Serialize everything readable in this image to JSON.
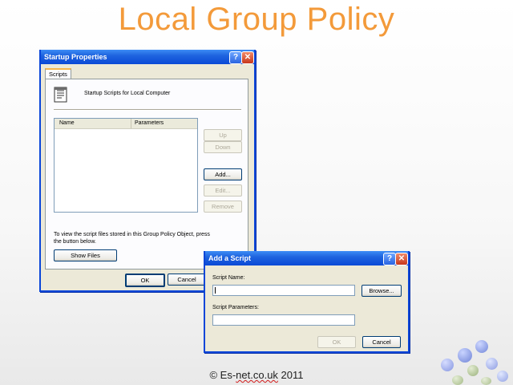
{
  "slide": {
    "title": "Local Group Policy",
    "footer_prefix": "© Es-",
    "footer_wavy": "net.co.uk",
    "footer_suffix": " 2011"
  },
  "startup_dialog": {
    "title": "Startup Properties",
    "help_glyph": "?",
    "close_glyph": "✕",
    "tab_label": "Scripts",
    "heading": "Startup Scripts for Local Computer",
    "columns": [
      "Name",
      "Parameters"
    ],
    "buttons": {
      "up": "Up",
      "down": "Down",
      "add": "Add...",
      "edit": "Edit...",
      "remove": "Remove",
      "show_files": "Show Files",
      "ok": "OK",
      "cancel": "Cancel"
    },
    "info_text": "To view the script files stored in this Group Policy Object, press the button below."
  },
  "add_script_dialog": {
    "title": "Add a Script",
    "help_glyph": "?",
    "close_glyph": "✕",
    "script_name_label": "Script Name:",
    "script_name_value": "",
    "script_params_label": "Script Parameters:",
    "script_params_value": "",
    "buttons": {
      "browse": "Browse...",
      "ok": "OK",
      "cancel": "Cancel"
    }
  },
  "colors": {
    "title_orange": "#f39a3a",
    "xp_blue": "#0a49d6",
    "dialog_bg": "#ece9d8"
  },
  "icons": {
    "script_icon": "script-document-icon",
    "help_icon": "help-icon",
    "close_icon": "close-icon"
  }
}
